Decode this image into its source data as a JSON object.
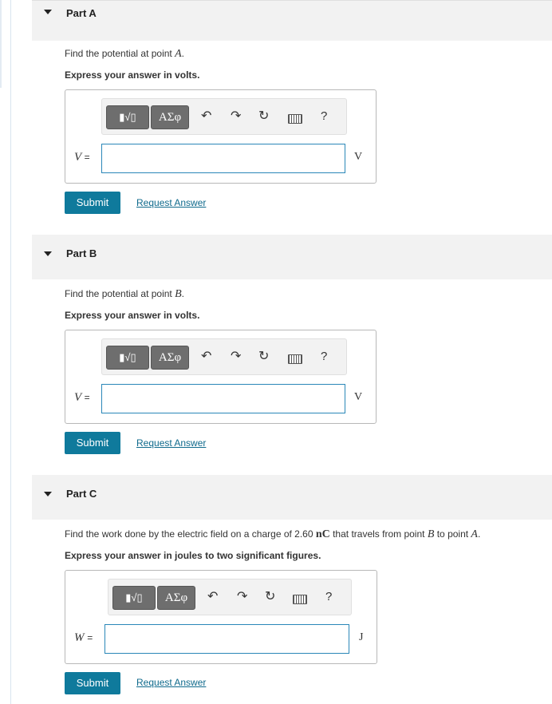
{
  "parts": [
    {
      "title": "Part A",
      "prompt_pre": "Find the potential at point ",
      "prompt_var": "A",
      "prompt_post": ".",
      "instruction": "Express your answer in volts.",
      "variable": "V",
      "equals": "=",
      "unit": "V",
      "input_value": "",
      "submit_label": "Submit",
      "request_label": "Request Answer"
    },
    {
      "title": "Part B",
      "prompt_pre": "Find the potential at point ",
      "prompt_var": "B",
      "prompt_post": ".",
      "instruction": "Express your answer in volts.",
      "variable": "V",
      "equals": "=",
      "unit": "V",
      "input_value": "",
      "submit_label": "Submit",
      "request_label": "Request Answer"
    },
    {
      "title": "Part C",
      "prompt_pre": "Find the work done by the electric field on a charge of 2.60 ",
      "prompt_unit": "nC",
      "prompt_mid": " that travels from point ",
      "prompt_var": "B",
      "prompt_mid2": " to point ",
      "prompt_var2": "A",
      "prompt_post": ".",
      "instruction": "Express your answer in joules to two significant figures.",
      "variable": "W",
      "equals": "=",
      "unit": "J",
      "input_value": "",
      "submit_label": "Submit",
      "request_label": "Request Answer"
    }
  ],
  "toolbar": {
    "templates_label": "▮√▯",
    "greek_label": "ΑΣφ",
    "undo_icon": "undo-icon",
    "redo_icon": "redo-icon",
    "reset_icon": "reset-icon",
    "keyboard_icon": "keyboard-icon",
    "help_label": "?"
  }
}
